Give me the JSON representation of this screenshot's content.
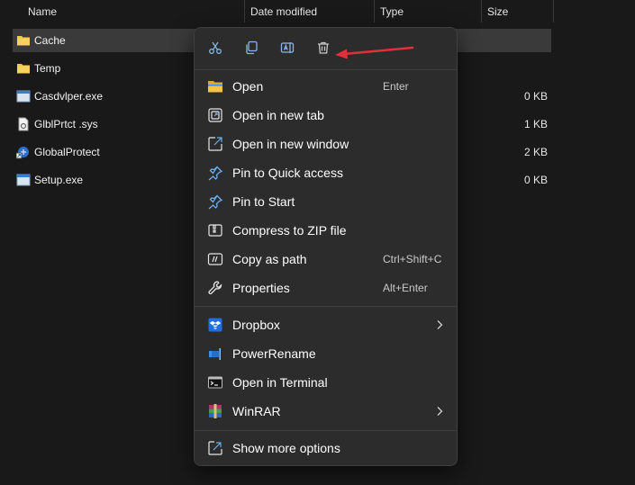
{
  "columns": {
    "name": "Name",
    "date_modified": "Date modified",
    "type": "Type",
    "size": "Size"
  },
  "files": [
    {
      "name": "Cache",
      "size": "",
      "icon": "folder-icon",
      "selected": true
    },
    {
      "name": "Temp",
      "size": "",
      "icon": "folder-icon",
      "selected": false
    },
    {
      "name": "Casdvlper.exe",
      "size": "0 KB",
      "icon": "exe-icon",
      "selected": false
    },
    {
      "name": "GlblPrtct .sys",
      "size": "1 KB",
      "icon": "sys-file-icon",
      "selected": false
    },
    {
      "name": "GlobalProtect",
      "size": "2 KB",
      "icon": "shortcut-icon",
      "selected": false
    },
    {
      "name": "Setup.exe",
      "size": "0 KB",
      "icon": "exe-icon",
      "selected": false
    }
  ],
  "quick_actions": [
    "cut-icon",
    "copy-icon",
    "rename-icon",
    "delete-icon"
  ],
  "menu": {
    "group1": [
      {
        "label": "Open",
        "shortcut": "Enter",
        "icon": "folder-open-icon"
      },
      {
        "label": "Open in new tab",
        "shortcut": "",
        "icon": "new-tab-icon"
      },
      {
        "label": "Open in new window",
        "shortcut": "",
        "icon": "new-window-icon"
      },
      {
        "label": "Pin to Quick access",
        "shortcut": "",
        "icon": "pin-icon"
      },
      {
        "label": "Pin to Start",
        "shortcut": "",
        "icon": "pin-icon"
      },
      {
        "label": "Compress to ZIP file",
        "shortcut": "",
        "icon": "zip-icon"
      },
      {
        "label": "Copy as path",
        "shortcut": "Ctrl+Shift+C",
        "icon": "copy-path-icon"
      },
      {
        "label": "Properties",
        "shortcut": "Alt+Enter",
        "icon": "wrench-icon"
      }
    ],
    "group2": [
      {
        "label": "Dropbox",
        "submenu": true,
        "icon": "dropbox-icon"
      },
      {
        "label": "PowerRename",
        "submenu": false,
        "icon": "powerrename-icon"
      },
      {
        "label": "Open in Terminal",
        "submenu": false,
        "icon": "terminal-icon"
      },
      {
        "label": "WinRAR",
        "submenu": true,
        "icon": "winrar-icon"
      }
    ],
    "group3": [
      {
        "label": "Show more options",
        "icon": "show-more-icon"
      }
    ]
  },
  "colors": {
    "background": "#191919",
    "menu_bg": "#2c2c2c",
    "accent_blue": "#60a5e6",
    "arrow_red": "#e0303a",
    "folder_yellow": "#f5c542"
  }
}
